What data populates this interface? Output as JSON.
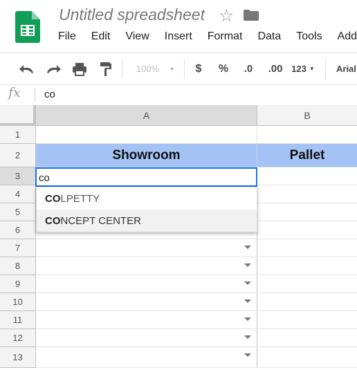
{
  "app": {
    "doc_title": "Untitled spreadsheet",
    "menu": [
      "File",
      "Edit",
      "View",
      "Insert",
      "Format",
      "Data",
      "Tools",
      "Add-o"
    ]
  },
  "toolbar": {
    "undo_icon": "undo-icon",
    "redo_icon": "redo-icon",
    "print_icon": "print-icon",
    "paint_format_icon": "paint-format-icon",
    "zoom": "100%",
    "currency": "$",
    "percent": "%",
    "decrease_decimal": ".0",
    "increase_decimal": ".00",
    "more_formats": "123",
    "font": "Arial"
  },
  "formula_bar": {
    "fx": "fx",
    "value": "co"
  },
  "grid": {
    "columns": [
      "A",
      "B"
    ],
    "rows": [
      "1",
      "2",
      "3",
      "4",
      "5",
      "6",
      "7",
      "8",
      "9",
      "10",
      "11",
      "12",
      "13"
    ],
    "header_cells": {
      "A2": "Showroom",
      "B2": "Pallet"
    },
    "active_cell_text": "co",
    "header_fill": "#a4c2f4",
    "selection_color": "#1a73e8"
  },
  "autocomplete": {
    "items": [
      {
        "match": "CO",
        "rest": "LPETTY"
      },
      {
        "match": "CO",
        "rest": "NCEPT CENTER"
      }
    ]
  }
}
